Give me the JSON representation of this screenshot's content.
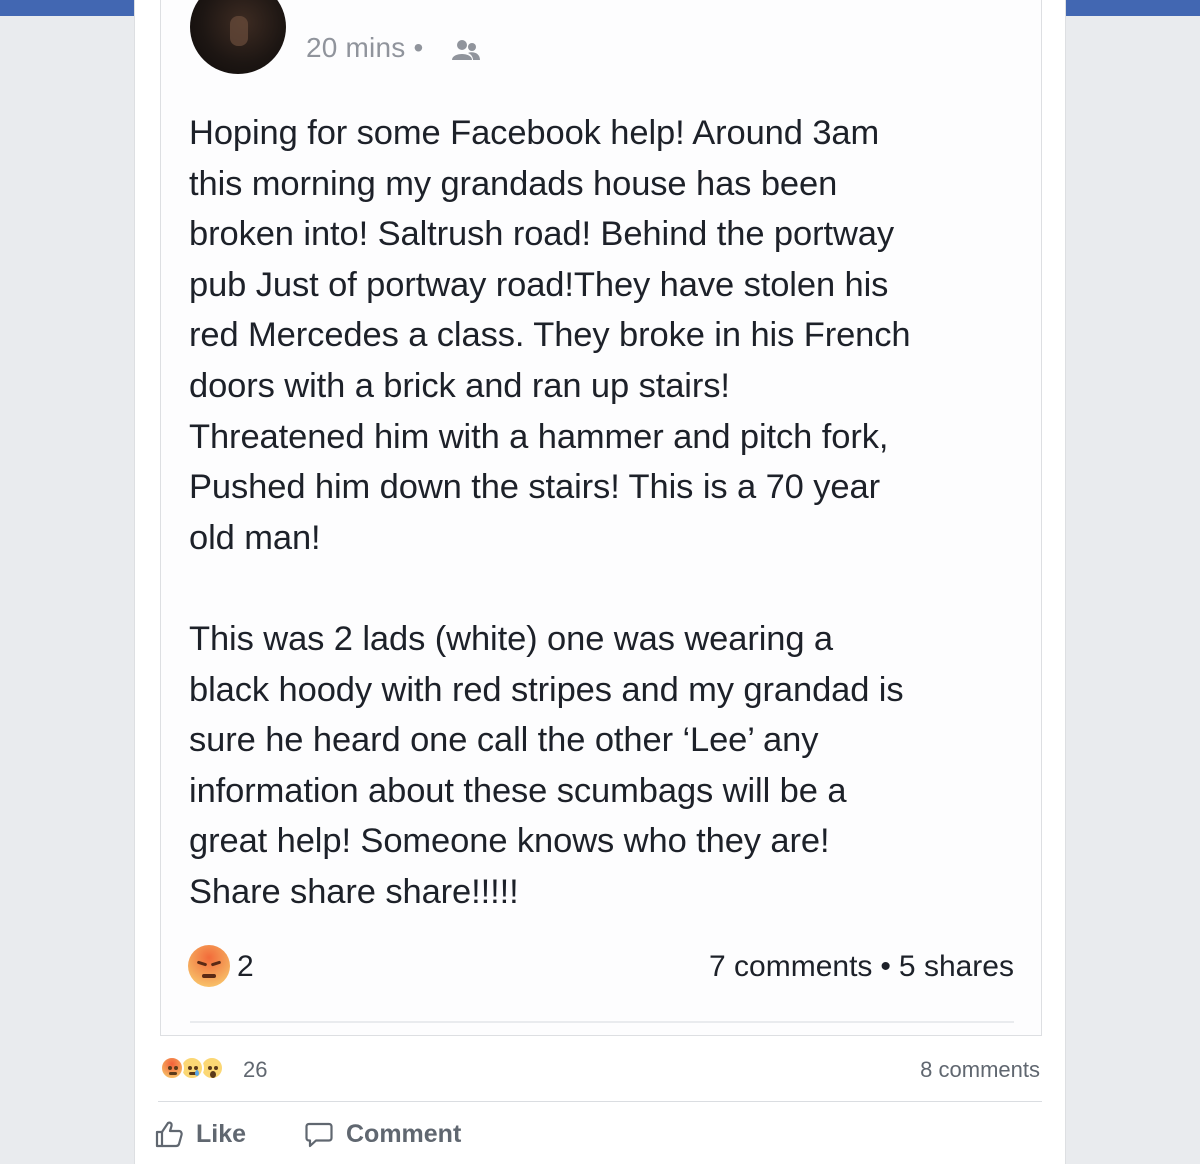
{
  "post": {
    "time": "20 mins",
    "separator": "•",
    "audience_icon": "friends-icon",
    "text": "Hoping for some Facebook help! Around 3am\nthis morning my grandads house has been\nbroken into! Saltrush road! Behind the portway\npub Just of portway road!They have stolen his\nred Mercedes a class. They broke in his French\ndoors with a brick and ran up stairs!\nThreatened him with a hammer and pitch fork,\nPushed him down the stairs! This is a 70 year\nold man!\n\nThis was 2 lads (white) one was wearing a\nblack hoody with red stripes and my grandad is\nsure he heard one call the other ‘Lee’ any\ninformation about these scumbags will be a\ngreat help! Someone knows who they are!\nShare share share!!!!!",
    "reaction_icon": "angry-emoji",
    "reaction_count": "2",
    "comments": "7 comments",
    "stats_separator": "•",
    "shares": "5 shares"
  },
  "outer": {
    "reaction_icons": [
      "angry-emoji",
      "sad-emoji",
      "wow-emoji"
    ],
    "reaction_count": "26",
    "comments": "8 comments",
    "actions": {
      "like_label": "Like",
      "comment_label": "Comment"
    }
  },
  "colors": {
    "topbar": "#4267b2",
    "page_bg": "#e9ebee",
    "text": "#1d2129",
    "meta_text": "#90949c",
    "action_text": "#606770"
  }
}
